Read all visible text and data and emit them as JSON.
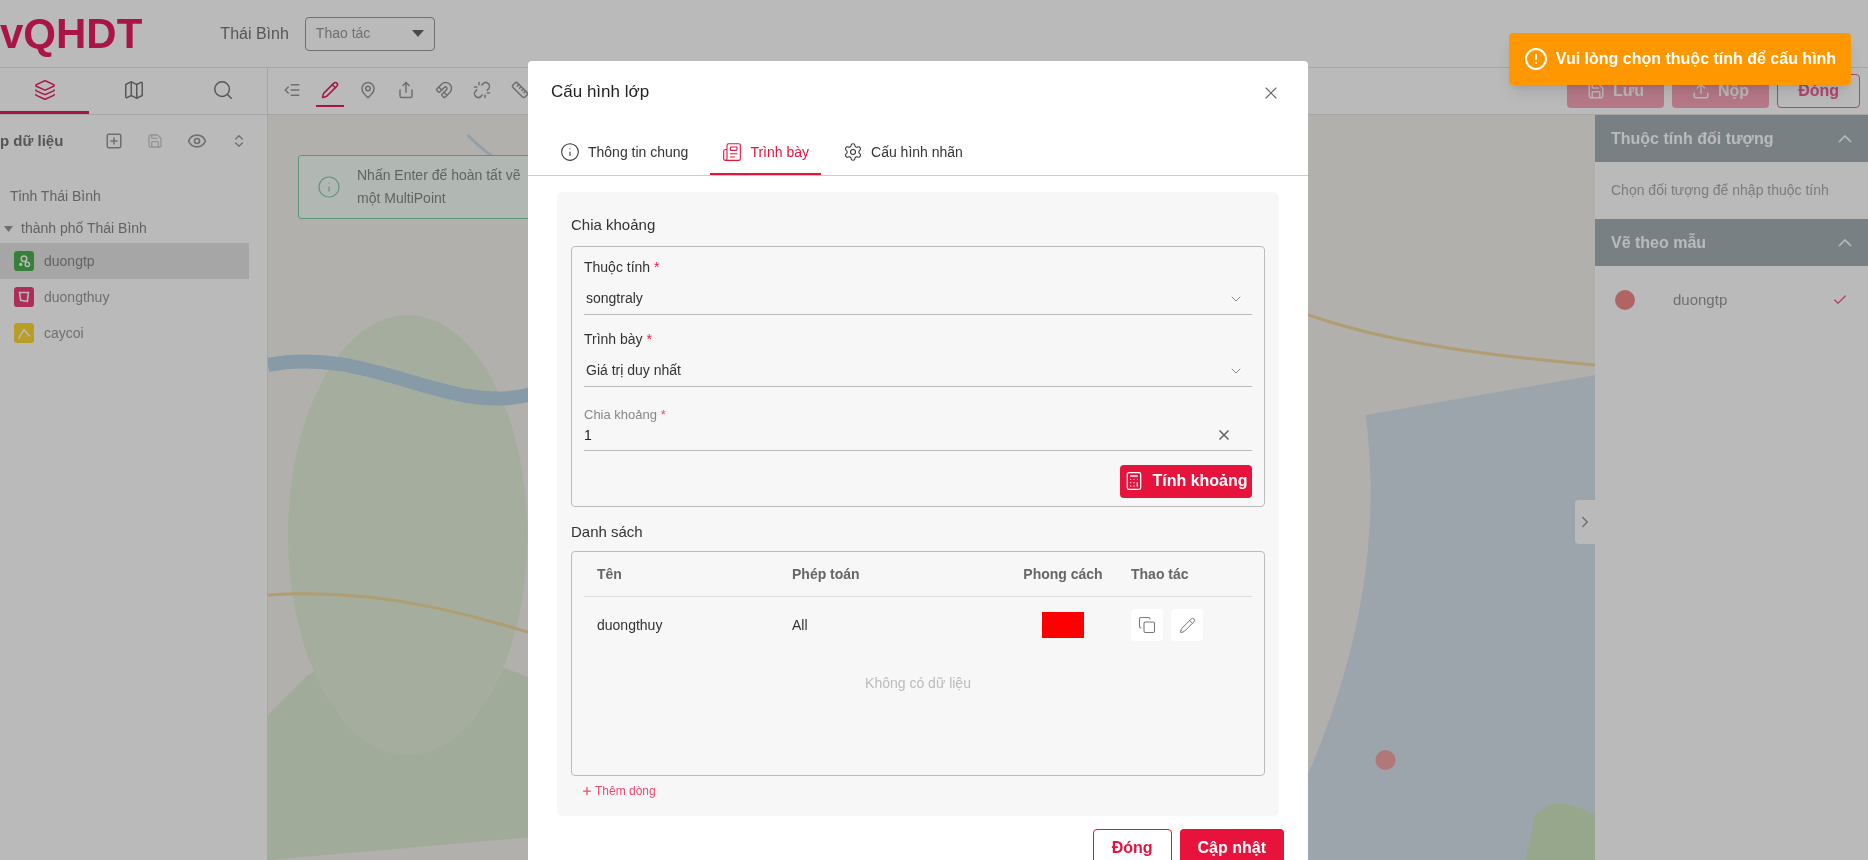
{
  "app": {
    "logo": "vQHDT",
    "region": "Thái Bình",
    "action_select": {
      "placeholder": "Thao tác"
    }
  },
  "sidebar": {
    "tabs": [
      {
        "kind": "layers",
        "selected": true
      },
      {
        "kind": "map",
        "selected": false
      },
      {
        "kind": "search",
        "selected": false
      }
    ],
    "title": "p dữ liệu",
    "tree": [
      {
        "label": "Tỉnh Thái Bình",
        "children": [
          {
            "label": "thành phố Thái Bình",
            "expanded": true,
            "children": [
              {
                "label": "duongtp",
                "kind": "point",
                "selected": true
              },
              {
                "label": "duongthuy",
                "kind": "polygon",
                "selected": false
              },
              {
                "label": "caycoi",
                "kind": "line",
                "selected": false
              }
            ]
          }
        ]
      }
    ]
  },
  "toolbar": [
    {
      "kind": "list",
      "selected": false
    },
    {
      "kind": "draw",
      "selected": true
    },
    {
      "kind": "pin",
      "selected": false
    },
    {
      "kind": "export",
      "selected": false
    },
    {
      "kind": "magnet",
      "selected": false
    },
    {
      "kind": "unlink",
      "selected": false
    },
    {
      "kind": "ruler",
      "selected": false
    }
  ],
  "alert": {
    "lines": [
      "Nhấn Enter để hoàn tất vẽ",
      "một MultiPoint"
    ]
  },
  "actions": [
    {
      "label": "Lưu",
      "kind": "save"
    },
    {
      "label": "Nộp",
      "kind": "submit"
    },
    {
      "label": "Đóng",
      "kind": "close"
    }
  ],
  "right_panel": [
    {
      "title": "Thuộc tính đối tượng",
      "expanded": true,
      "hint": "Chọn đối tượng để nhập thuộc tính"
    },
    {
      "title": "Vẽ theo mẫu",
      "expanded": true,
      "items": [
        {
          "label": "duongtp",
          "checked": true
        }
      ]
    }
  ],
  "toast": {
    "text": "Vui lòng chọn thuộc tính để cấu hình"
  },
  "modal": {
    "title": "Cấu hình lớp",
    "tabs": [
      {
        "label": "Thông tin chung",
        "kind": "info",
        "selected": false
      },
      {
        "label": "Trình bày",
        "kind": "style",
        "selected": true
      },
      {
        "label": "Cấu hình nhãn",
        "kind": "gear",
        "selected": false
      }
    ],
    "section_title": "Chia khoảng",
    "fields": [
      {
        "kind": "select",
        "label": "Thuộc tính",
        "required_mark": "*",
        "value": "songtraly"
      },
      {
        "kind": "select",
        "label": "Trình bày",
        "required_mark": "*",
        "value": "Giá trị duy nhất"
      },
      {
        "kind": "input",
        "label": "Chia khoảng",
        "required_mark": "*",
        "value": "1"
      }
    ],
    "compute_button": "Tính khoảng",
    "list_title": "Danh sách",
    "table": {
      "columns": [
        "Tên",
        "Phép toán",
        "Phong cách",
        "Thao tác"
      ],
      "rows": [
        {
          "name": "duongthuy",
          "operator": "All",
          "color": "#ff0000"
        }
      ],
      "empty_text": "Không có dữ liệu"
    },
    "add_row": "Thêm dòng",
    "buttons": [
      {
        "label": "Đóng",
        "kind": "secondary"
      },
      {
        "label": "Cập nhật",
        "kind": "primary"
      }
    ]
  }
}
